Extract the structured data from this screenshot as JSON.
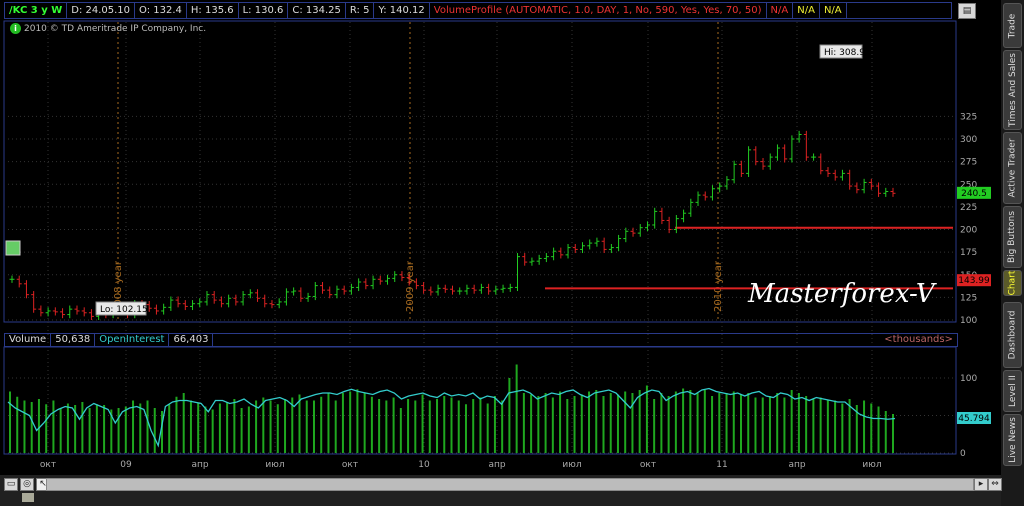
{
  "header": {
    "symbol": "/KC 3 y W",
    "date": "D: 24.05.10",
    "open": "O: 132.4",
    "high": "H: 135.6",
    "low": "L: 130.6",
    "close": "C: 134.25",
    "range": "R: 5",
    "y": "Y: 140.12",
    "study": "VolumeProfile (AUTOMATIC, 1.0, DAY, 1, No, 590, Yes, Yes, 70, 50)",
    "na1": "N/A",
    "na2": "N/A",
    "na3": "N/A"
  },
  "copyright": "2010 © TD Ameritrade IP Company, Inc.",
  "watermark": "Masterforex-V",
  "price_axis": {
    "labels": [
      "325",
      "300",
      "275",
      "250",
      "225",
      "200",
      "175",
      "150",
      "125",
      "100"
    ],
    "values": [
      325,
      300,
      275,
      250,
      225,
      200,
      175,
      150,
      125,
      100
    ],
    "last_price": "240.5",
    "line_price": "143.99",
    "last_value": 240.5,
    "marker_value": 143.99
  },
  "annotations": {
    "high": "Hi: 308.9",
    "low": "Lo: 102.15",
    "year1": "2009 year",
    "year2": "2010 year",
    "year0": "2008 year"
  },
  "levels": [
    202,
    135
  ],
  "indicator": {
    "volume_label": "Volume",
    "volume_value": "50,638",
    "oi_label": "OpenInterest",
    "oi_value": "66,403",
    "units": "<thousands>",
    "axis_labels": [
      "100",
      "50",
      "0"
    ],
    "oi_last": "45.794"
  },
  "x_axis": {
    "labels": [
      "окт",
      "09",
      "апр",
      "июл",
      "окт",
      "10",
      "апр",
      "июл",
      "окт",
      "11",
      "апр",
      "июл"
    ]
  },
  "right_tabs": [
    "Trade",
    "Times And Sales",
    "Active Trader",
    "Big Buttons",
    "Chart",
    "Dashboard",
    "Level II",
    "Live News"
  ],
  "colors": {
    "up": "#22cc22",
    "down": "#dd2222",
    "oi": "#33cccc",
    "level": "#dd2222",
    "grid": "#333"
  },
  "chart_data": {
    "type": "ohlc",
    "ylim": [
      90,
      335
    ],
    "closes": [
      145,
      140,
      128,
      112,
      108,
      110,
      109,
      106,
      112,
      110,
      108,
      104,
      110,
      106,
      112,
      111,
      106,
      118,
      117,
      113,
      110,
      114,
      122,
      118,
      115,
      118,
      120,
      128,
      122,
      118,
      124,
      120,
      128,
      130,
      124,
      118,
      117,
      120,
      131,
      132,
      124,
      126,
      138,
      133,
      128,
      134,
      132,
      136,
      142,
      138,
      145,
      143,
      146,
      150,
      147,
      142,
      138,
      133,
      131,
      135,
      134,
      132,
      132,
      135,
      133,
      136,
      132,
      134,
      135,
      136,
      170,
      164,
      165,
      168,
      170,
      176,
      172,
      180,
      178,
      182,
      185,
      187,
      178,
      180,
      190,
      198,
      196,
      202,
      205,
      220,
      210,
      200,
      212,
      218,
      230,
      238,
      236,
      245,
      248,
      255,
      272,
      262,
      288,
      275,
      270,
      280,
      290,
      278,
      300,
      305,
      280,
      280,
      265,
      262,
      258,
      262,
      248,
      244,
      252,
      248,
      240,
      242,
      240
    ],
    "volume": [
      82,
      75,
      70,
      68,
      72,
      65,
      70,
      60,
      66,
      64,
      68,
      60,
      65,
      64,
      58,
      60,
      62,
      70,
      66,
      70,
      60,
      56,
      65,
      75,
      80,
      70,
      67,
      62,
      58,
      66,
      68,
      72,
      60,
      62,
      70,
      74,
      70,
      65,
      72,
      74,
      78,
      70,
      70,
      75,
      80,
      70,
      80,
      82,
      85,
      80,
      75,
      72,
      70,
      74,
      60,
      72,
      70,
      78,
      70,
      72,
      76,
      74,
      70,
      65,
      72,
      74,
      66,
      76,
      70,
      100,
      118,
      80,
      78,
      76,
      80,
      74,
      82,
      72,
      76,
      78,
      82,
      84,
      76,
      80,
      78,
      82,
      80,
      84,
      90,
      72,
      80,
      76,
      82,
      86,
      84,
      80,
      84,
      76,
      80,
      80,
      82,
      78,
      80,
      74,
      74,
      76,
      80,
      74,
      84,
      80,
      76,
      72,
      74,
      70,
      70,
      66,
      72,
      64,
      70,
      66,
      62,
      56,
      52
    ],
    "open_interest": [
      68,
      60,
      55,
      50,
      30,
      40,
      52,
      58,
      62,
      60,
      45,
      60,
      66,
      62,
      58,
      40,
      55,
      60,
      62,
      58,
      30,
      10,
      62,
      68,
      70,
      70,
      68,
      66,
      55,
      70,
      70,
      66,
      68,
      72,
      65,
      60,
      70,
      72,
      74,
      70,
      62,
      72,
      75,
      78,
      80,
      80,
      78,
      82,
      85,
      82,
      80,
      78,
      82,
      84,
      80,
      72,
      76,
      78,
      80,
      76,
      74,
      80,
      76,
      78,
      76,
      80,
      72,
      76,
      74,
      65,
      80,
      82,
      84,
      80,
      72,
      76,
      80,
      78,
      82,
      84,
      78,
      74,
      80,
      82,
      84,
      80,
      70,
      60,
      74,
      80,
      84,
      82,
      70,
      76,
      80,
      82,
      78,
      84,
      86,
      82,
      80,
      78,
      80,
      76,
      80,
      82,
      76,
      74,
      80,
      78,
      72,
      74,
      70,
      74,
      72,
      70,
      68,
      68,
      60,
      52,
      48,
      46,
      46,
      45,
      46
    ]
  }
}
